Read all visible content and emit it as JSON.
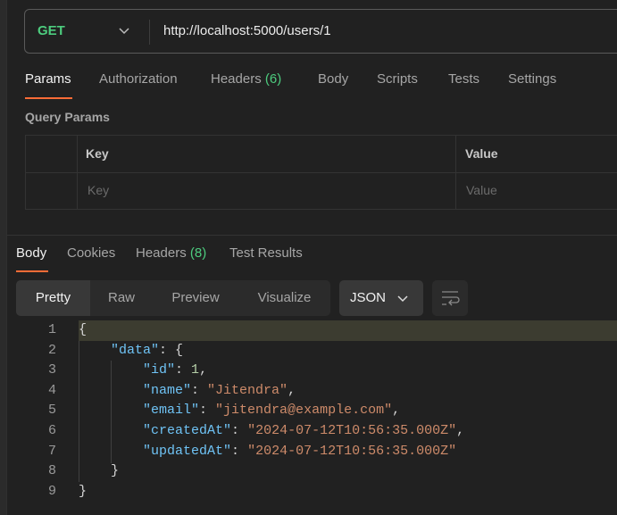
{
  "request": {
    "method": "GET",
    "url": "http://localhost:5000/users/1"
  },
  "request_tabs": [
    {
      "label": "Params",
      "active": true
    },
    {
      "label": "Authorization"
    },
    {
      "label": "Headers",
      "count": "(6)"
    },
    {
      "label": "Body"
    },
    {
      "label": "Scripts"
    },
    {
      "label": "Tests"
    },
    {
      "label": "Settings"
    }
  ],
  "query_params": {
    "title": "Query Params",
    "columns": [
      "Key",
      "Value"
    ],
    "placeholders": {
      "key": "Key",
      "value": "Value"
    }
  },
  "response_tabs": [
    {
      "label": "Body",
      "active": true
    },
    {
      "label": "Cookies"
    },
    {
      "label": "Headers",
      "count": "(8)"
    },
    {
      "label": "Test Results"
    }
  ],
  "format_tabs": [
    {
      "label": "Pretty",
      "active": true
    },
    {
      "label": "Raw"
    },
    {
      "label": "Preview"
    },
    {
      "label": "Visualize"
    }
  ],
  "language_select": "JSON",
  "wrap_icon": "wrap-lines-icon",
  "response_body": {
    "line_numbers": [
      "1",
      "2",
      "3",
      "4",
      "5",
      "6",
      "7",
      "8",
      "9"
    ],
    "data": {
      "id": 1,
      "name": "Jitendra",
      "email": "jitendra@example.com",
      "createdAt": "2024-07-12T10:56:35.000Z",
      "updatedAt": "2024-07-12T10:56:35.000Z"
    },
    "tokens": {
      "data_key": "\"data\"",
      "id_key": "\"id\"",
      "id_val": "1",
      "name_key": "\"name\"",
      "name_val": "\"Jitendra\"",
      "email_key": "\"email\"",
      "email_val": "\"jitendra@example.com\"",
      "created_key": "\"createdAt\"",
      "created_val": "\"2024-07-12T10:56:35.000Z\"",
      "updated_key": "\"updatedAt\"",
      "updated_val": "\"2024-07-12T10:56:35.000Z\""
    }
  },
  "colors": {
    "accent": "#ff6c37",
    "method_get": "#4dcc7e",
    "json_key": "#6fc3f5",
    "json_string": "#ce8b6a",
    "json_number": "#b5cea8"
  }
}
